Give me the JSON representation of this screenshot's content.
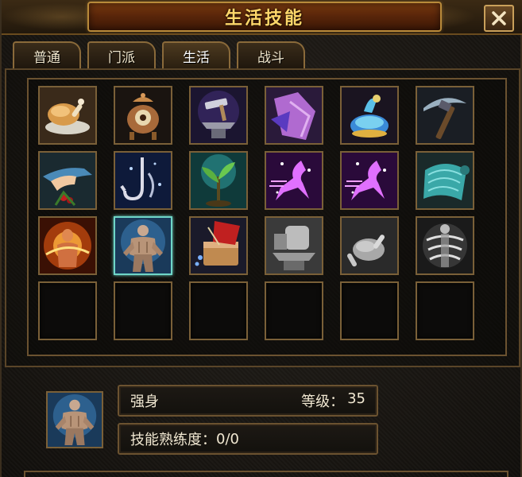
{
  "window": {
    "title": "生活技能",
    "close_symbol": "✕"
  },
  "tabs": [
    {
      "label": "普通",
      "active": false
    },
    {
      "label": "门派",
      "active": false
    },
    {
      "label": "生活",
      "active": true
    },
    {
      "label": "战斗",
      "active": false
    }
  ],
  "skill_slots": [
    {
      "icon": "roast-chicken-icon"
    },
    {
      "icon": "alchemy-cauldron-icon"
    },
    {
      "icon": "anvil-hammer-icon"
    },
    {
      "icon": "purple-robe-icon"
    },
    {
      "icon": "potion-flask-icon"
    },
    {
      "icon": "pickaxe-icon"
    },
    {
      "icon": "herb-gathering-hand-icon"
    },
    {
      "icon": "fishing-hook-icon"
    },
    {
      "icon": "sapling-icon"
    },
    {
      "icon": "purple-dash-icon"
    },
    {
      "icon": "purple-dash-icon"
    },
    {
      "icon": "teal-scroll-icon"
    },
    {
      "icon": "flame-aura-icon"
    },
    {
      "icon": "muscle-body-icon",
      "selected": true
    },
    {
      "icon": "tailoring-fabric-icon"
    },
    {
      "icon": "gray-anvil-icon"
    },
    {
      "icon": "gray-roast-chicken-icon"
    },
    {
      "icon": "gray-whirlwind-icon"
    },
    {
      "icon": "empty-slot"
    },
    {
      "icon": "empty-slot"
    },
    {
      "icon": "empty-slot"
    },
    {
      "icon": "empty-slot"
    },
    {
      "icon": "empty-slot"
    },
    {
      "icon": "empty-slot"
    }
  ],
  "selected_skill": {
    "icon": "muscle-body-icon",
    "name": "强身",
    "level_label": "等级：",
    "level_value": "35",
    "proficiency_label": "技能熟练度：",
    "proficiency_value": "0/0"
  },
  "colors": {
    "title_gold": "#ffd76a",
    "frame_bronze": "#7a6038",
    "selection_teal": "#6fd6c8"
  }
}
